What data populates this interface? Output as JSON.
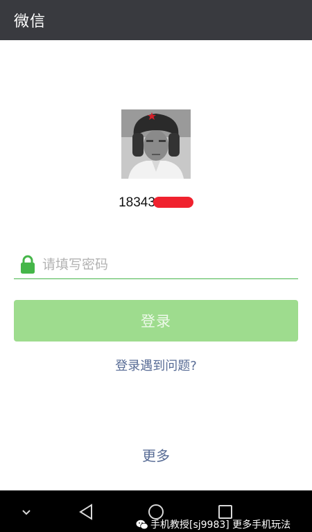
{
  "titlebar": {
    "title": "微信"
  },
  "account": {
    "phone_visible": "18343"
  },
  "password": {
    "placeholder": "请填写密码"
  },
  "login": {
    "button_label": "登录",
    "problem_link": "登录遇到问题?"
  },
  "more": {
    "label": "更多"
  },
  "navbar": {
    "icons": [
      "chevron-down-icon",
      "back-icon",
      "home-icon",
      "recents-icon"
    ]
  },
  "watermark": {
    "text": "手机教授[sj9983]  更多手机玩法"
  },
  "colors": {
    "titlebar": "#393a3f",
    "accent": "#45b649",
    "login_button": "#9edc8e",
    "link": "#576b95",
    "redaction": "#f0222e"
  }
}
